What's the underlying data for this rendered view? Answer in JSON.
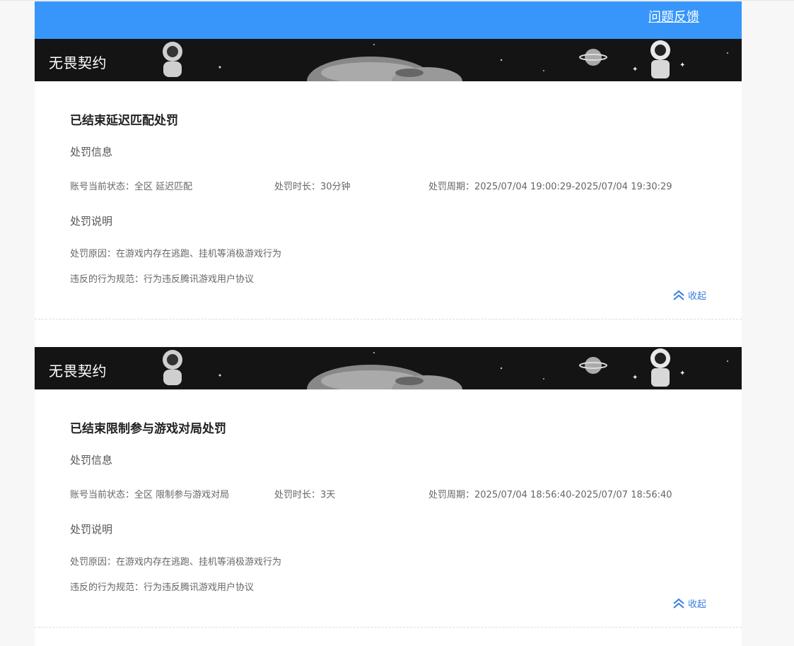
{
  "header": {
    "feedback_label": "问题反馈"
  },
  "colors": {
    "header_bg": "#3896fb",
    "banner_bg": "#141414",
    "link_blue": "#3a7ee0"
  },
  "sections": [
    {
      "banner_title": "无畏契约",
      "penalty_title": "已结束延迟匹配处罚",
      "info_heading": "处罚信息",
      "status": "账号当前状态：全区 延迟匹配",
      "duration": "处罚时长：30分钟",
      "period": "处罚周期：2025/07/04 19:00:29-2025/07/04 19:30:29",
      "explain_heading": "处罚说明",
      "reason": "处罚原因：在游戏内存在逃跑、挂机等消极游戏行为",
      "rule": "违反的行为规范：行为违反腾讯游戏用户协议",
      "collapse_label": "收起"
    },
    {
      "banner_title": "无畏契约",
      "penalty_title": "已结束限制参与游戏对局处罚",
      "info_heading": "处罚信息",
      "status": "账号当前状态：全区 限制参与游戏对局",
      "duration": "处罚时长：3天",
      "period": "处罚周期：2025/07/04 18:56:40-2025/07/07 18:56:40",
      "explain_heading": "处罚说明",
      "reason": "处罚原因：在游戏内存在逃跑、挂机等消极游戏行为",
      "rule": "违反的行为规范：行为违反腾讯游戏用户协议",
      "collapse_label": "收起"
    }
  ]
}
